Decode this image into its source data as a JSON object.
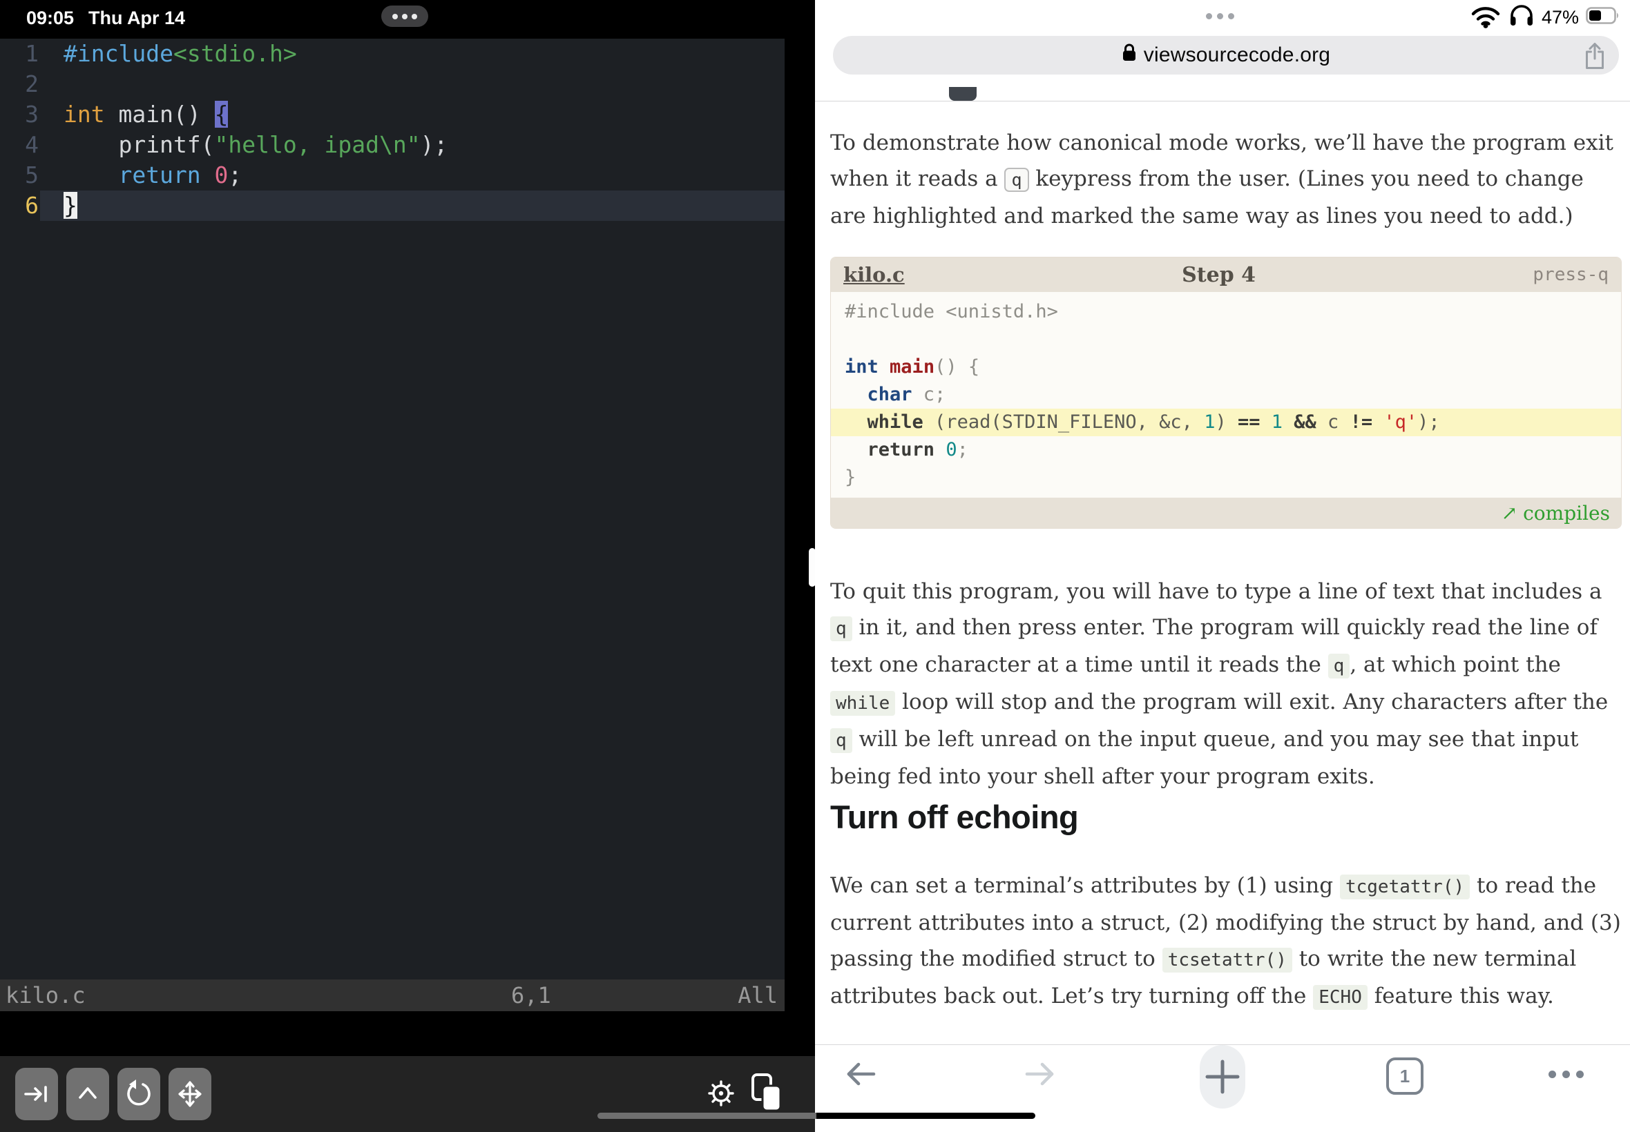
{
  "status": {
    "time": "09:05",
    "date": "Thu Apr 14",
    "battery": "47%"
  },
  "terminal": {
    "editor": {
      "lines": [
        {
          "n": "1",
          "current": false,
          "segs": [
            {
              "t": "#include",
              "c": "inc"
            },
            {
              "t": "<stdio.h>",
              "c": "str"
            }
          ]
        },
        {
          "n": "2",
          "current": false,
          "segs": []
        },
        {
          "n": "3",
          "current": false,
          "segs": [
            {
              "t": "int ",
              "c": "kw"
            },
            {
              "t": "main() ",
              "c": "fg"
            },
            {
              "t": "{",
              "c": "brace"
            }
          ]
        },
        {
          "n": "4",
          "current": false,
          "segs": [
            {
              "t": "    printf(",
              "c": "fg"
            },
            {
              "t": "\"hello, ipad\\n\"",
              "c": "str"
            },
            {
              "t": ");",
              "c": "fg"
            }
          ]
        },
        {
          "n": "5",
          "current": false,
          "segs": [
            {
              "t": "    return ",
              "c": "ret"
            },
            {
              "t": "0",
              "c": "num"
            },
            {
              "t": ";",
              "c": "fg"
            }
          ]
        },
        {
          "n": "6",
          "current": true,
          "segs": [
            {
              "t": "}",
              "c": "cursor"
            }
          ]
        }
      ]
    },
    "statusline": {
      "file": "kilo.c",
      "position": "6,1",
      "scroll": "All"
    },
    "toolbar": {
      "keys": [
        "tab",
        "control",
        "escape",
        "arrow-keys"
      ],
      "right": [
        "settings",
        "paste"
      ]
    }
  },
  "safari": {
    "address": {
      "url": "viewsourcecode.org"
    },
    "content": {
      "para1": [
        {
          "t": "To demonstrate how canonical mode works, we’ll have the program exit when it reads a "
        },
        {
          "t": "q",
          "k": "kbd"
        },
        {
          "t": " keypress from the user. (Lines you need to change are highlighted and marked the same way as lines you need to add.)"
        }
      ],
      "codeblock": {
        "file": "kilo.c",
        "step": "Step 4",
        "tag": "press-q",
        "lines": [
          {
            "hl": false,
            "segs": [
              {
                "t": "#include <unistd.h>",
                "c": "dim"
              }
            ]
          },
          {
            "hl": false,
            "segs": []
          },
          {
            "hl": false,
            "segs": [
              {
                "t": "int",
                "c": "kw"
              },
              {
                "t": " ",
                "c": "dim"
              },
              {
                "t": "main",
                "c": "fn"
              },
              {
                "t": "() {",
                "c": "dim"
              }
            ]
          },
          {
            "hl": false,
            "segs": [
              {
                "t": "  ",
                "c": "dim"
              },
              {
                "t": "char",
                "c": "kw"
              },
              {
                "t": " c;",
                "c": "dim"
              }
            ]
          },
          {
            "hl": true,
            "segs": [
              {
                "t": "  ",
                "c": "d"
              },
              {
                "t": "while",
                "c": "b"
              },
              {
                "t": " (read(STDIN_FILENO, &c, ",
                "c": "d"
              },
              {
                "t": "1",
                "c": "num"
              },
              {
                "t": ") ",
                "c": "d"
              },
              {
                "t": "==",
                "c": "b"
              },
              {
                "t": " ",
                "c": "d"
              },
              {
                "t": "1",
                "c": "num"
              },
              {
                "t": " ",
                "c": "d"
              },
              {
                "t": "&&",
                "c": "b"
              },
              {
                "t": " c ",
                "c": "d"
              },
              {
                "t": "!=",
                "c": "b"
              },
              {
                "t": " ",
                "c": "d"
              },
              {
                "t": "'q'",
                "c": "str"
              },
              {
                "t": ");",
                "c": "d"
              }
            ]
          },
          {
            "hl": false,
            "segs": [
              {
                "t": "  ",
                "c": "dim"
              },
              {
                "t": "return",
                "c": "b"
              },
              {
                "t": " ",
                "c": "dim"
              },
              {
                "t": "0",
                "c": "num"
              },
              {
                "t": ";",
                "c": "dim"
              }
            ]
          },
          {
            "hl": false,
            "segs": [
              {
                "t": "}",
                "c": "dim"
              }
            ]
          }
        ],
        "footer": "compiles",
        "footer_icon": "↗"
      },
      "para2": [
        {
          "t": "To quit this program, you will have to type a line of text that includes a "
        },
        {
          "t": "q",
          "k": "code"
        },
        {
          "t": " in it, and then press enter. The program will quickly read the line of text one character at a time until it reads the "
        },
        {
          "t": "q",
          "k": "code"
        },
        {
          "t": ", at which point the "
        },
        {
          "t": "while",
          "k": "code"
        },
        {
          "t": " loop will stop and the program will exit. Any characters after the "
        },
        {
          "t": "q",
          "k": "code"
        },
        {
          "t": " will be left unread on the input queue, and you may see that input being fed into your shell after your program exits."
        }
      ],
      "heading": "Turn off echoing",
      "para3": [
        {
          "t": "We can set a terminal’s attributes by (1) using "
        },
        {
          "t": "tcgetattr()",
          "k": "code"
        },
        {
          "t": " to read the current attributes into a struct, (2) modifying the struct by hand, and (3) passing the modified struct to "
        },
        {
          "t": "tcsetattr()",
          "k": "code"
        },
        {
          "t": " to write the new terminal attributes back out. Let’s try turning off the "
        },
        {
          "t": "ECHO",
          "k": "code"
        },
        {
          "t": " feature this way."
        }
      ]
    },
    "toolbar": {
      "tab_count": "1"
    }
  },
  "colors": {
    "vim_keyword": "#dfa040",
    "vim_string": "#58a75b",
    "vim_include": "#5ca8dd",
    "vim_number": "#e06c8c",
    "vim_line_highlight": "#2a2f38",
    "vim_current_linenr": "#e8c35a",
    "code_highlight_bg": "#fbf6c3",
    "code_header_bg": "#e7e1d7",
    "compiles_green": "#2f9e2f",
    "inline_code_bg": "#edf1e9",
    "address_pill_bg": "#e9e9eb"
  }
}
